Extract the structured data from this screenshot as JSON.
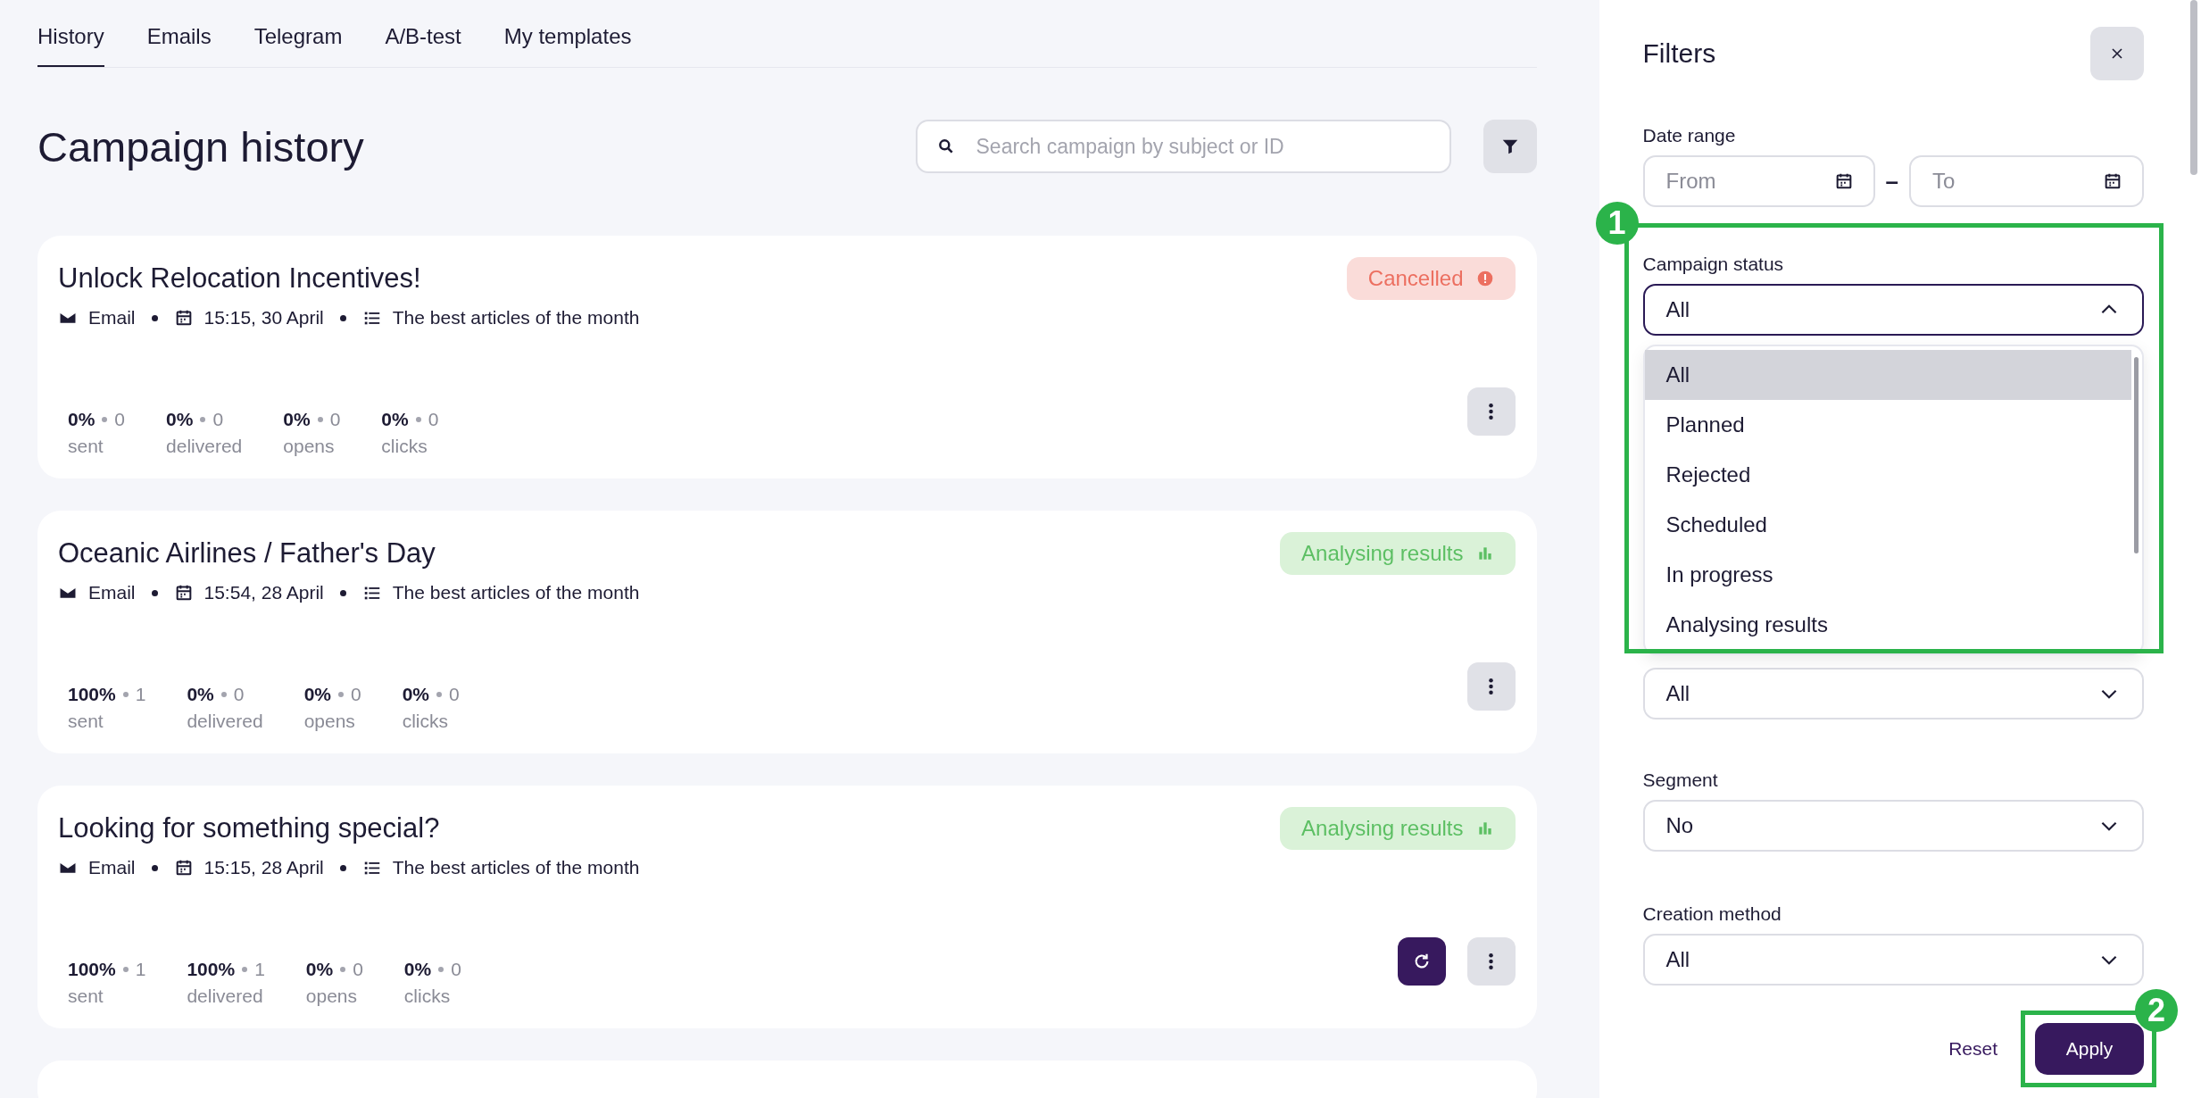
{
  "tabs": [
    {
      "label": "History",
      "selected": true
    },
    {
      "label": "Emails",
      "selected": false
    },
    {
      "label": "Telegram",
      "selected": false
    },
    {
      "label": "A/B-test",
      "selected": false
    },
    {
      "label": "My templates",
      "selected": false
    }
  ],
  "page_title": "Campaign history",
  "search": {
    "placeholder": "Search campaign by subject or ID"
  },
  "campaigns": [
    {
      "title": "Unlock Relocation Incentives!",
      "status": {
        "label": "Cancelled",
        "kind": "cancelled"
      },
      "channel": "Email",
      "datetime": "15:15, 30 April",
      "list": "The best articles of the month",
      "retry": false,
      "stats": [
        {
          "percent": "0%",
          "count": "0",
          "label": "sent"
        },
        {
          "percent": "0%",
          "count": "0",
          "label": "delivered"
        },
        {
          "percent": "0%",
          "count": "0",
          "label": "opens"
        },
        {
          "percent": "0%",
          "count": "0",
          "label": "clicks"
        }
      ]
    },
    {
      "title": "Oceanic Airlines / Father's Day",
      "status": {
        "label": "Analysing results",
        "kind": "analysing"
      },
      "channel": "Email",
      "datetime": "15:54, 28 April",
      "list": "The best articles of the month",
      "retry": false,
      "stats": [
        {
          "percent": "100%",
          "count": "1",
          "label": "sent"
        },
        {
          "percent": "0%",
          "count": "0",
          "label": "delivered"
        },
        {
          "percent": "0%",
          "count": "0",
          "label": "opens"
        },
        {
          "percent": "0%",
          "count": "0",
          "label": "clicks"
        }
      ]
    },
    {
      "title": "Looking for something special?",
      "status": {
        "label": "Analysing results",
        "kind": "analysing"
      },
      "channel": "Email",
      "datetime": "15:15, 28 April",
      "list": "The best articles of the month",
      "retry": true,
      "stats": [
        {
          "percent": "100%",
          "count": "1",
          "label": "sent"
        },
        {
          "percent": "100%",
          "count": "1",
          "label": "delivered"
        },
        {
          "percent": "0%",
          "count": "0",
          "label": "opens"
        },
        {
          "percent": "0%",
          "count": "0",
          "label": "clicks"
        }
      ]
    }
  ],
  "filters": {
    "title": "Filters",
    "date_range": {
      "label": "Date range",
      "from_placeholder": "From",
      "separator": "–",
      "to_placeholder": "To"
    },
    "campaign_status": {
      "label": "Campaign status",
      "value": "All",
      "expanded": true,
      "annotation": "1",
      "options": [
        {
          "label": "All",
          "selected": true
        },
        {
          "label": "Planned",
          "selected": false
        },
        {
          "label": "Rejected",
          "selected": false
        },
        {
          "label": "Scheduled",
          "selected": false
        },
        {
          "label": "In progress",
          "selected": false
        },
        {
          "label": "Analysing results",
          "selected": false
        }
      ]
    },
    "list": {
      "value": "All"
    },
    "segment": {
      "label": "Segment",
      "value": "No"
    },
    "creation_method": {
      "label": "Creation method",
      "value": "All"
    },
    "reset": "Reset",
    "apply": {
      "label": "Apply",
      "annotation": "2"
    }
  }
}
